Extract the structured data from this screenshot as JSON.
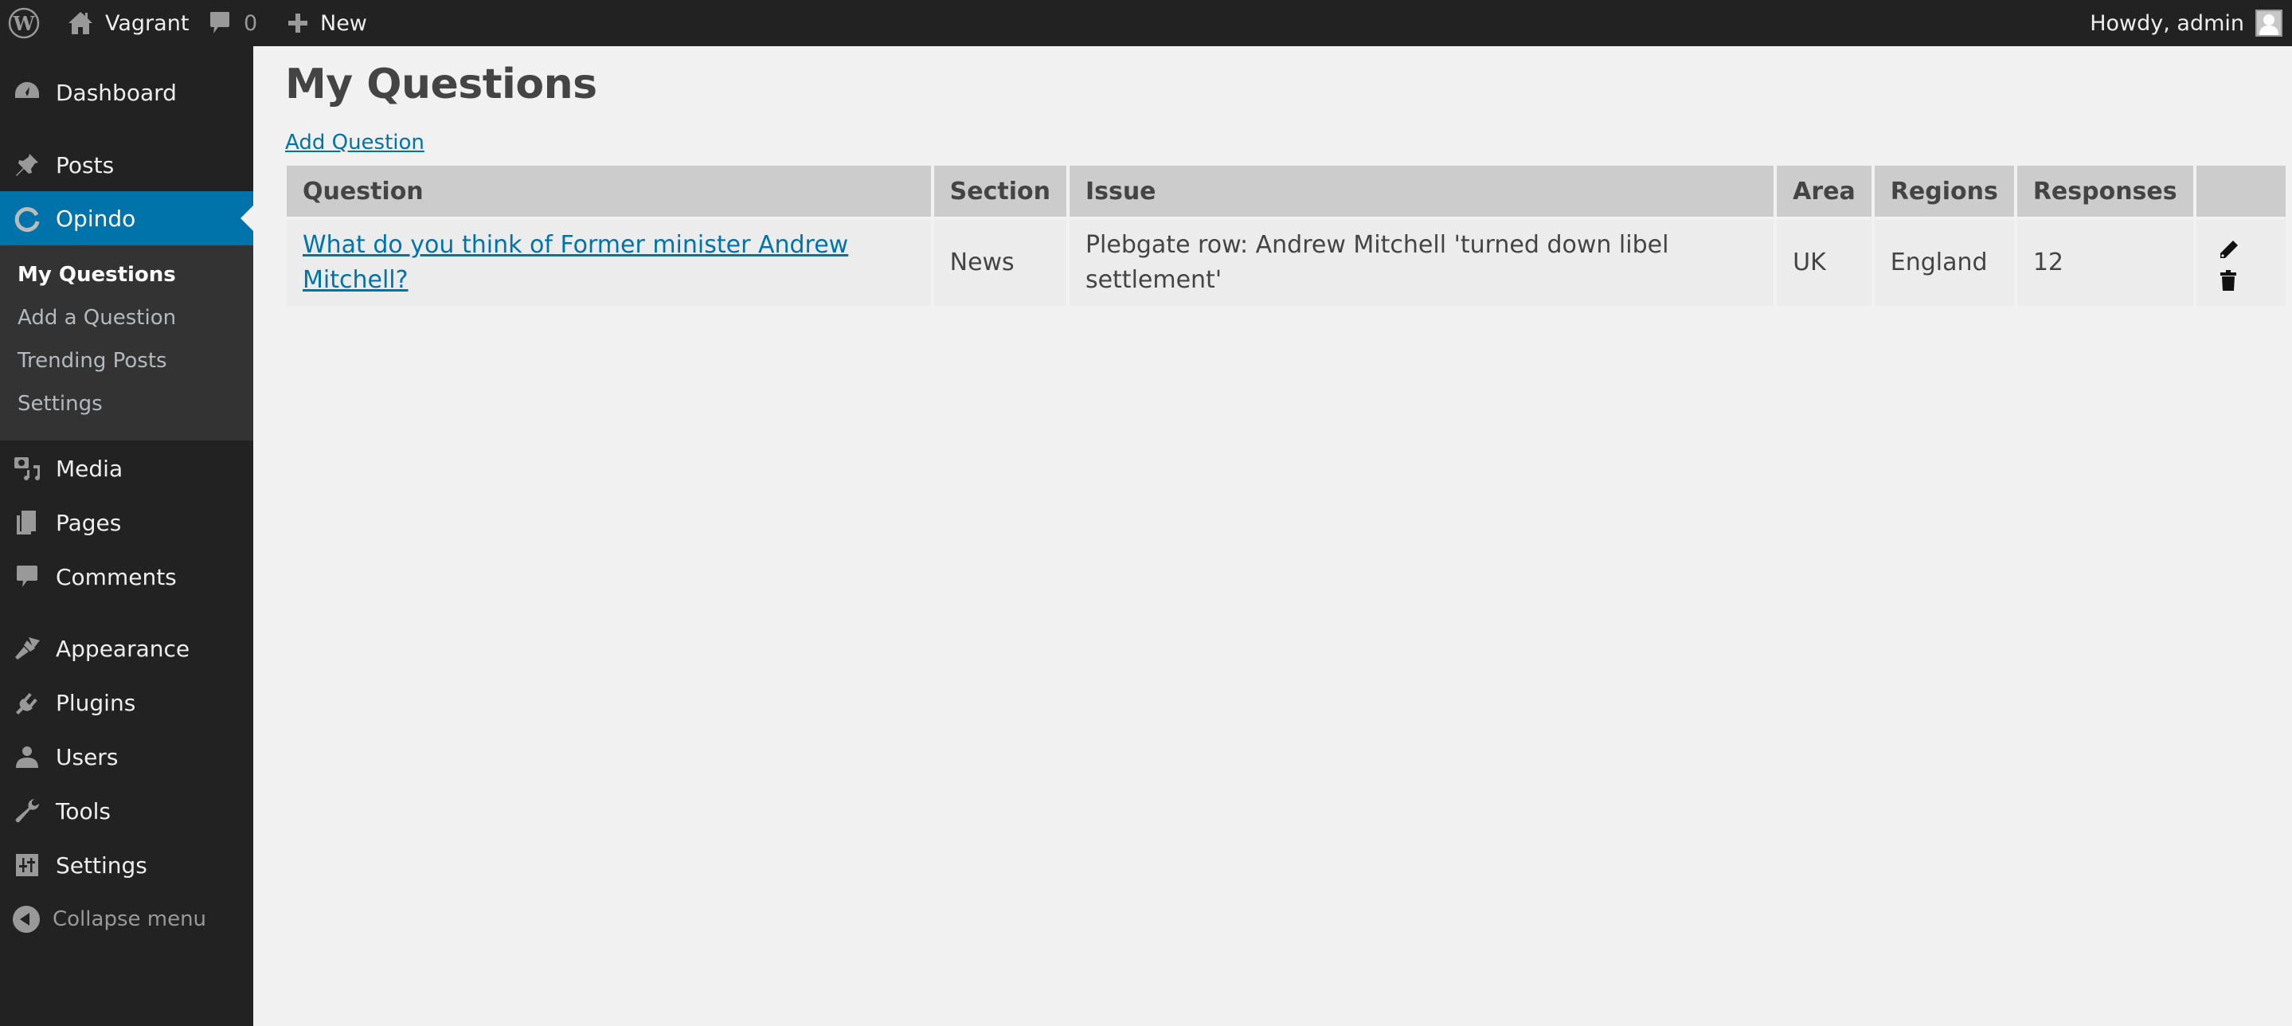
{
  "adminbar": {
    "site_name": "Vagrant",
    "comments_count": "0",
    "new_label": "New",
    "account_label": "Howdy, admin"
  },
  "sidebar": {
    "items": [
      {
        "label": "Dashboard",
        "icon": "dashboard-icon"
      },
      {
        "label": "Posts",
        "icon": "pin-icon"
      },
      {
        "label": "Opindo",
        "icon": "opindo-icon",
        "current": true
      },
      {
        "label": "Media",
        "icon": "media-icon"
      },
      {
        "label": "Pages",
        "icon": "pages-icon"
      },
      {
        "label": "Comments",
        "icon": "comment-icon"
      },
      {
        "label": "Appearance",
        "icon": "brush-icon"
      },
      {
        "label": "Plugins",
        "icon": "plug-icon"
      },
      {
        "label": "Users",
        "icon": "user-icon"
      },
      {
        "label": "Tools",
        "icon": "wrench-icon"
      },
      {
        "label": "Settings",
        "icon": "sliders-icon"
      }
    ],
    "submenu": [
      {
        "label": "My Questions",
        "current": true
      },
      {
        "label": "Add a Question"
      },
      {
        "label": "Trending Posts"
      },
      {
        "label": "Settings"
      }
    ],
    "collapse_label": "Collapse menu"
  },
  "main": {
    "title": "My Questions",
    "add_link": "Add Question",
    "table": {
      "headers": [
        "Question",
        "Section",
        "Issue",
        "Area",
        "Regions",
        "Responses",
        ""
      ],
      "rows": [
        {
          "question": "What do you think of Former minister Andrew Mitchell?",
          "section": "News",
          "issue": "Plebgate row: Andrew Mitchell 'turned down libel settlement'",
          "area": "UK",
          "regions": "England",
          "responses": "12",
          "actions": [
            "edit-icon",
            "delete-icon"
          ]
        }
      ]
    }
  },
  "colors": {
    "adminbar_bg": "#222222",
    "sidebar_bg": "#222222",
    "submenu_bg": "#333333",
    "accent": "#0073aa",
    "content_bg": "#f1f1f1",
    "table_header_bg": "#cccccc",
    "table_cell_bg": "#ececec"
  }
}
